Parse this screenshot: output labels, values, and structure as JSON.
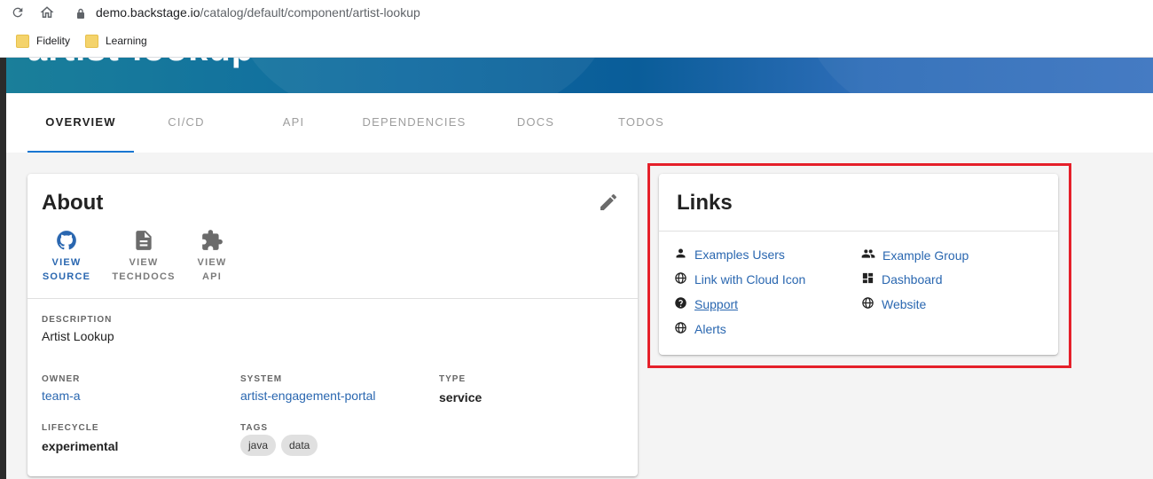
{
  "browser": {
    "url_host": "demo.backstage.io",
    "url_path": "/catalog/default/component/artist-lookup",
    "bookmarks": [
      "Fidelity",
      "Learning"
    ]
  },
  "header": {
    "title": "artist-lookup"
  },
  "tabs": [
    "OVERVIEW",
    "CI/CD",
    "API",
    "DEPENDENCIES",
    "DOCS",
    "TODOS"
  ],
  "about": {
    "title": "About",
    "icon_links": [
      {
        "line1": "VIEW",
        "line2": "SOURCE",
        "icon": "github-icon"
      },
      {
        "line1": "VIEW",
        "line2": "TECHDOCS",
        "icon": "document-icon"
      },
      {
        "line1": "VIEW",
        "line2": "API",
        "icon": "puzzle-icon"
      }
    ],
    "description_label": "DESCRIPTION",
    "description": "Artist Lookup",
    "owner_label": "OWNER",
    "owner": "team-a",
    "system_label": "SYSTEM",
    "system": "artist-engagement-portal",
    "type_label": "TYPE",
    "type": "service",
    "lifecycle_label": "LIFECYCLE",
    "lifecycle": "experimental",
    "tags_label": "TAGS",
    "tags": [
      "java",
      "data"
    ]
  },
  "links": {
    "title": "Links",
    "items": [
      {
        "label": "Examples Users",
        "icon": "person-icon"
      },
      {
        "label": "Example Group",
        "icon": "group-icon"
      },
      {
        "label": "Link with Cloud Icon",
        "icon": "globe-icon"
      },
      {
        "label": "Dashboard",
        "icon": "dashboard-icon"
      },
      {
        "label": "Support",
        "icon": "help-icon"
      },
      {
        "label": "Website",
        "icon": "globe-icon"
      },
      {
        "label": "Alerts",
        "icon": "globe-icon"
      }
    ]
  },
  "colors": {
    "link": "#2a67b0",
    "highlight": "#e5202a",
    "tab_indicator": "#1976d2"
  }
}
